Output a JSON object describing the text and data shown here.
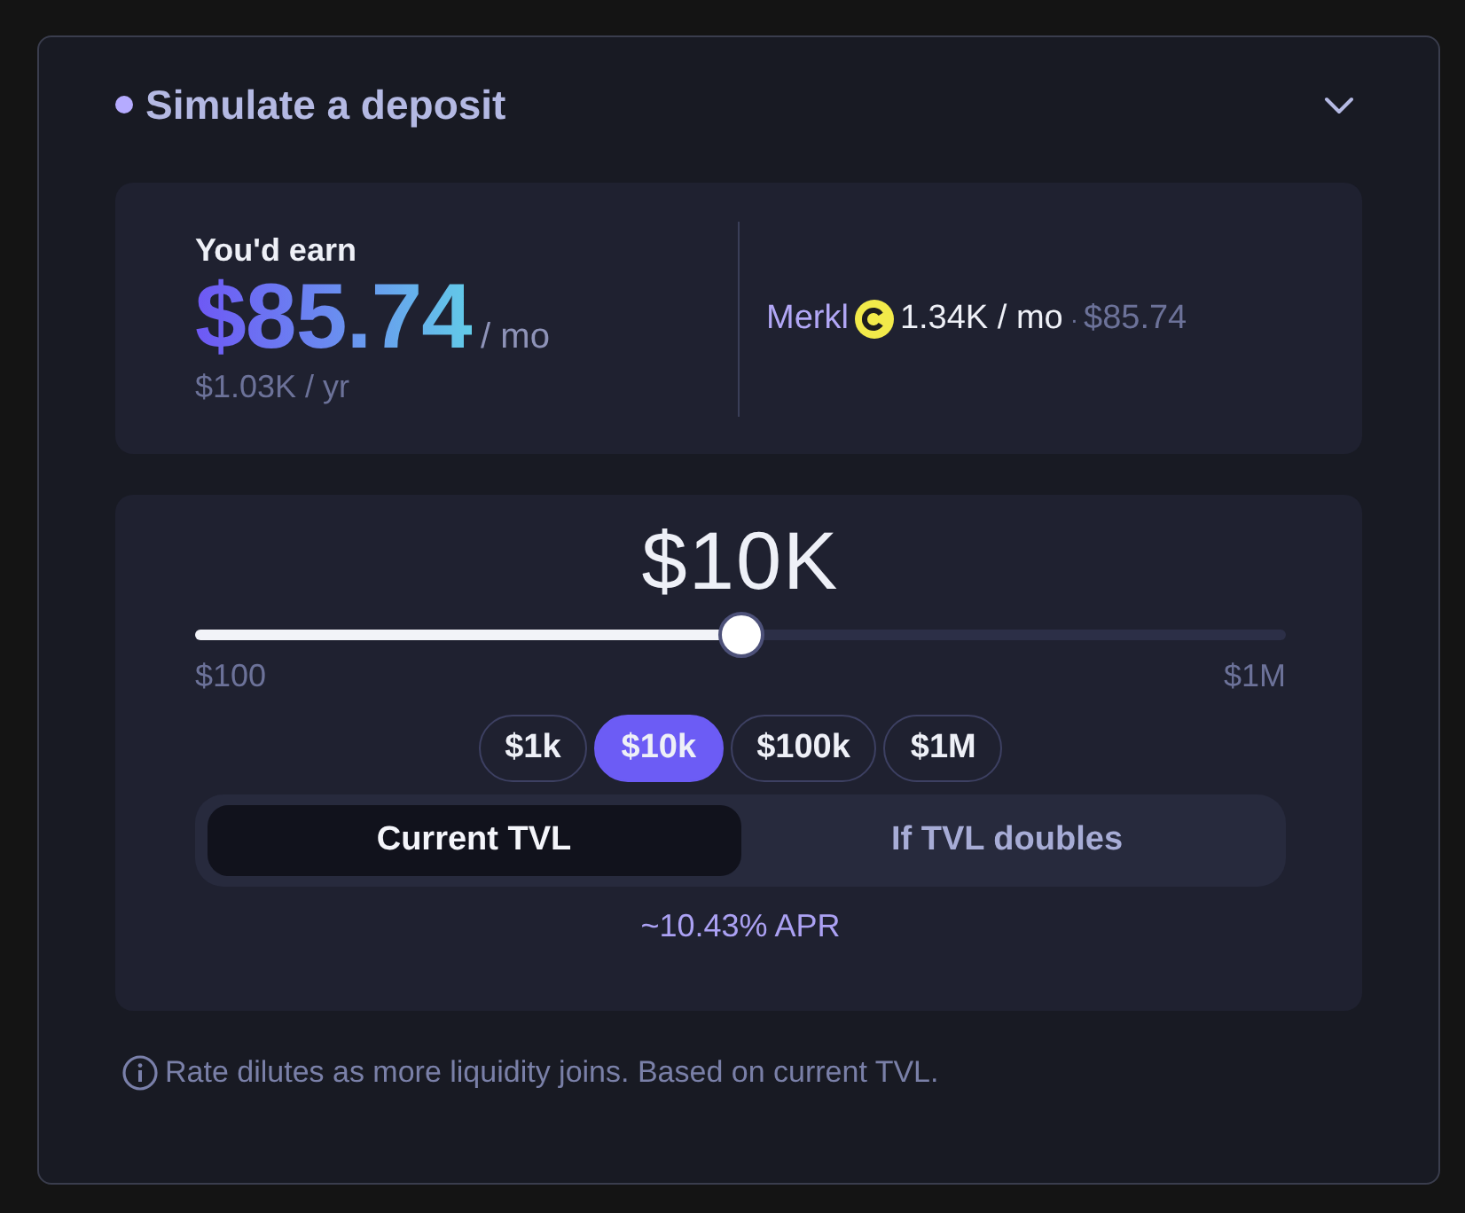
{
  "header": {
    "title": "Simulate a deposit",
    "expanded": true
  },
  "earnings": {
    "label": "You'd earn",
    "amount": "$85.74",
    "period": "/ mo",
    "yearly": "$1.03K / yr",
    "rewards": [
      {
        "source": "Merkl",
        "amount": "1.34K / mo",
        "separator": "·",
        "value": "$85.74"
      }
    ]
  },
  "deposit": {
    "amount": "$10K",
    "level": 0.5,
    "min": "$100",
    "max": "$1M",
    "presets": [
      {
        "label": "$1k",
        "selected": false
      },
      {
        "label": "$10k",
        "selected": true
      },
      {
        "label": "$100k",
        "selected": false
      },
      {
        "label": "$1M",
        "selected": false
      }
    ]
  },
  "scenarios": [
    {
      "label": "Current TVL",
      "selected": true
    },
    {
      "label": "If TVL doubles",
      "selected": false
    }
  ],
  "apr": "~10.43% APR",
  "note": "Rate dilutes as more liquidity joins. Based on current TVL."
}
